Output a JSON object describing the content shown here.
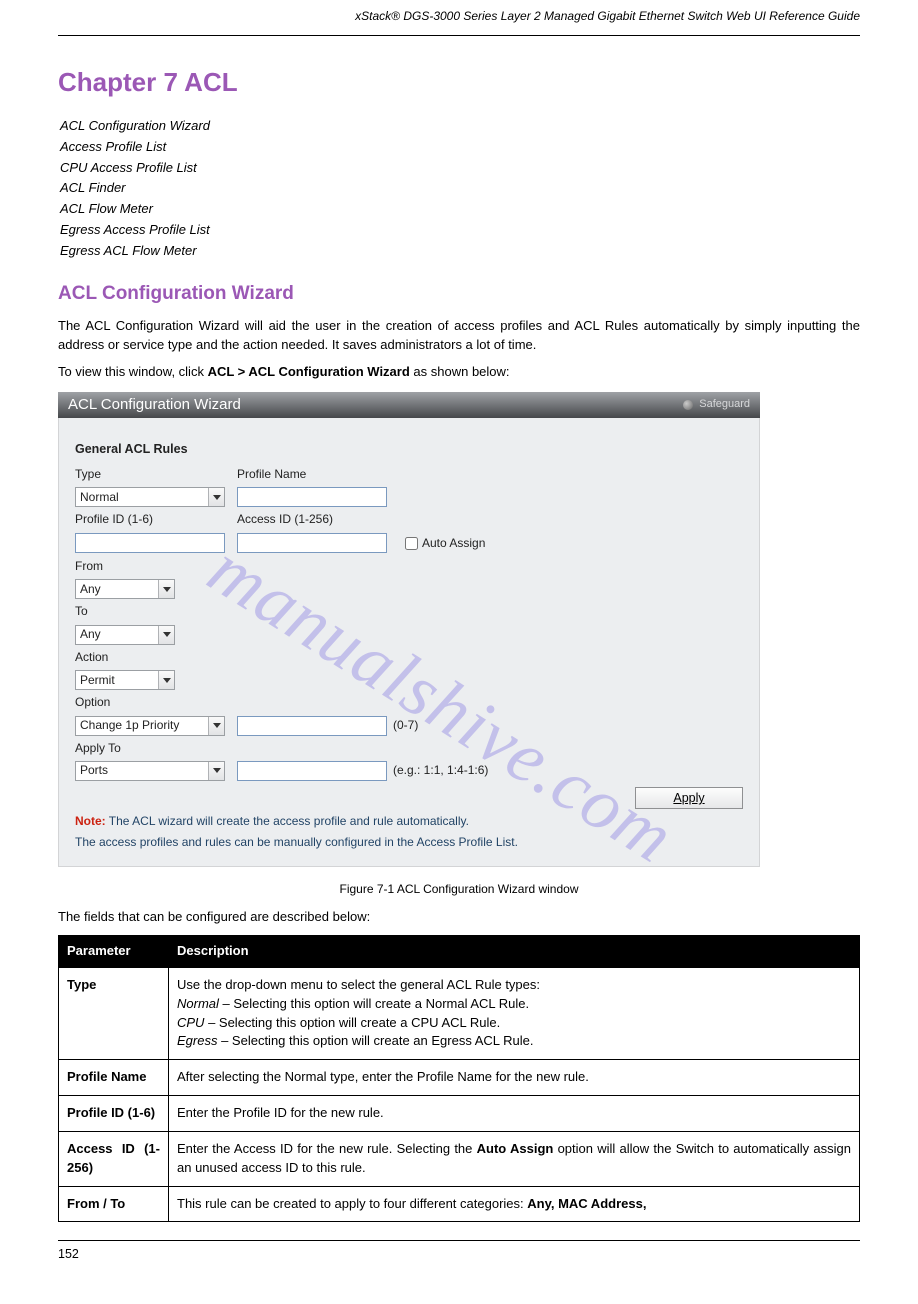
{
  "header": {
    "doc_title": "xStack® DGS-3000 Series Layer 2 Managed Gigabit Ethernet Switch Web UI Reference Guide"
  },
  "intro": {
    "h2": "Chapter 7 ACL",
    "items": [
      "ACL Configuration Wizard",
      "Access Profile List",
      "CPU Access Profile List",
      "ACL Finder",
      "ACL Flow Meter",
      "Egress Access Profile List",
      "Egress ACL Flow Meter"
    ]
  },
  "section": {
    "h3": "ACL Configuration Wizard",
    "p1": "The ACL Configuration Wizard will aid the user in the creation of access profiles and ACL Rules automatically by simply inputting the address or service type and the action needed. It saves administrators a lot of time.",
    "nav_prefix": "To view this window, click ",
    "nav_path": "ACL > ACL Configuration Wizard",
    "nav_suffix": " as shown below:"
  },
  "wizard": {
    "title": "ACL Configuration Wizard",
    "safeguard": "Safeguard",
    "section_title": "General ACL Rules",
    "labels": {
      "type": "Type",
      "profile_name": "Profile Name",
      "profile_id": "Profile ID (1-6)",
      "access_id": "Access ID (1-256)",
      "auto_assign": "Auto Assign",
      "from": "From",
      "to": "To",
      "action": "Action",
      "option": "Option",
      "option_hint": "(0-7)",
      "apply_to": "Apply To",
      "apply_hint": "(e.g.: 1:1, 1:4-1:6)"
    },
    "values": {
      "type": "Normal",
      "from": "Any",
      "to": "Any",
      "action": "Permit",
      "option": "Change 1p Priority",
      "apply_to": "Ports"
    },
    "apply_button": "Apply",
    "note_label": "Note:",
    "note_line1": " The ACL wizard will create the access profile and rule automatically.",
    "note_line2": "The access profiles and rules can be manually configured in the Access Profile List."
  },
  "figure_caption": "Figure 7-1 ACL Configuration Wizard window",
  "params_intro": "The fields that can be configured are described below:",
  "table": {
    "h_param": "Parameter",
    "h_desc": "Description",
    "rows": [
      {
        "name": "Type",
        "desc_pre": "Use the drop-down menu to select the general ACL Rule types: ",
        "opt1": "Normal",
        "opt1_desc": " – Selecting this option will create a Normal ACL Rule.",
        "opt2": "CPU",
        "opt2_desc": " – Selecting this option will create a CPU ACL Rule.",
        "opt3": "Egress",
        "opt3_desc": " – Selecting this option will create an Egress ACL Rule."
      },
      {
        "name": "Profile Name",
        "desc": "After selecting the Normal type, enter the Profile Name for the new rule."
      },
      {
        "name": "Profile ID (1-6)",
        "desc": "Enter the Profile ID for the new rule."
      },
      {
        "name": "Access ID (1-256)",
        "desc_pre": "Enter the Access ID for the new rule. Selecting the ",
        "bold": "Auto Assign",
        "desc_post": " option will allow the Switch to automatically assign an unused access ID to this rule."
      },
      {
        "name": "From / To",
        "desc_pre": "This rule can be created to apply to four different categories: ",
        "opts": "Any, MAC Address, "
      }
    ]
  },
  "page_number": "152",
  "watermark": "manualshive.com"
}
